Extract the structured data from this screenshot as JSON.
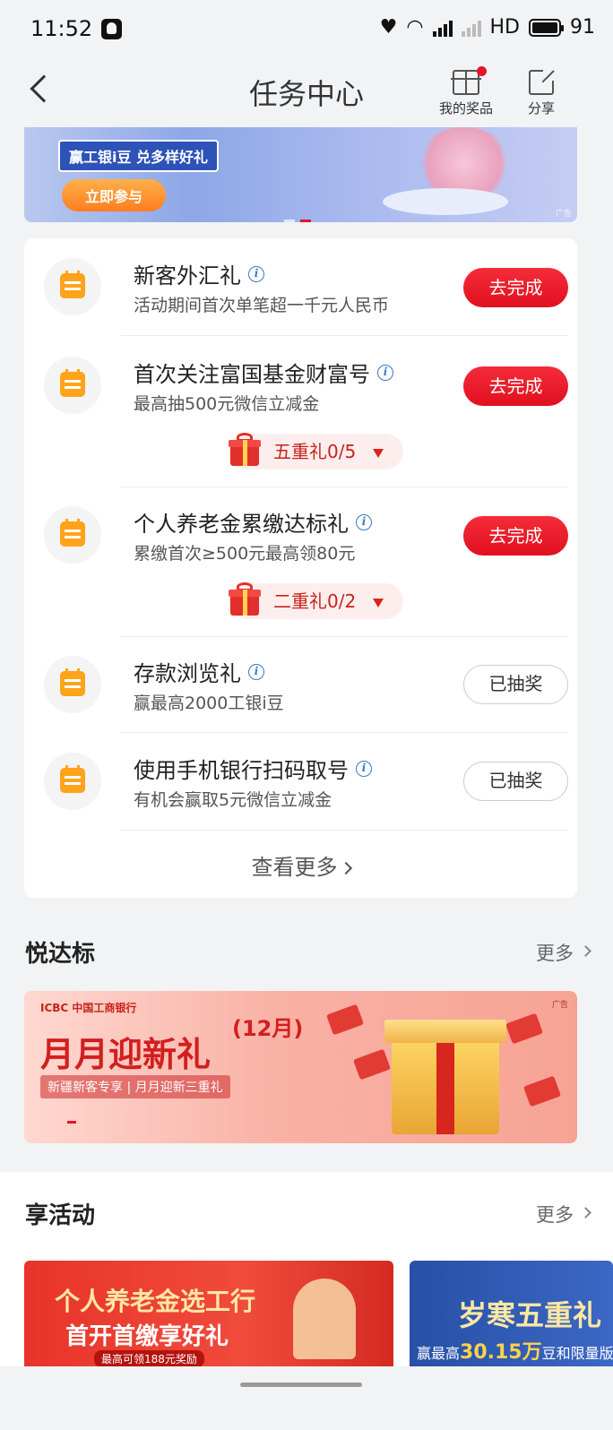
{
  "status_bar": {
    "time": "11:52",
    "network": "HD",
    "battery": "91"
  },
  "nav": {
    "title": "任务中心",
    "prizes_label": "我的奖品",
    "share_label": "分享"
  },
  "top_banner": {
    "tag": "赢工银i豆 兑多样好礼",
    "cta": "立即参与",
    "ad": "广告"
  },
  "tasks": [
    {
      "title": "新客外汇礼",
      "desc": "活动期间首次单笔超一千元人民币",
      "action": "去完成",
      "status": "todo"
    },
    {
      "title": "首次关注富国基金财富号",
      "desc": "最高抽500元微信立减金",
      "action": "去完成",
      "status": "todo",
      "pill": "五重礼0/5"
    },
    {
      "title": "个人养老金累缴达标礼",
      "desc": "累缴首次≥500元最高领80元",
      "action": "去完成",
      "status": "todo",
      "pill": "二重礼0/2"
    },
    {
      "title": "存款浏览礼",
      "desc": "赢最高2000工银i豆",
      "action": "已抽奖",
      "status": "done"
    },
    {
      "title": "使用手机银行扫码取号",
      "desc": "有机会赢取5元微信立减金",
      "action": "已抽奖",
      "status": "done"
    }
  ],
  "see_more": "查看更多",
  "section_yue": {
    "title": "悦达标",
    "more": "更多"
  },
  "mid_banner": {
    "brand": "ICBC 中国工商银行",
    "ad": "广告",
    "month": "(12月)",
    "headline": "月月迎新礼",
    "sub": "新疆新客专享 | 月月迎新三重礼"
  },
  "section_xiang": {
    "title": "享活动",
    "more": "更多"
  },
  "activities": [
    {
      "line1": "个人养老金选工行",
      "line2": "首开首缴享好礼",
      "line3": "最高可领188元奖励"
    },
    {
      "line1": "岁寒五重礼",
      "prefix": "赢最高",
      "amount": "30.15万",
      "suffix": "豆和限量版"
    }
  ],
  "colors": {
    "accent": "#e8122a",
    "task_icon": "#ffa31a",
    "info": "#3a78c6"
  }
}
